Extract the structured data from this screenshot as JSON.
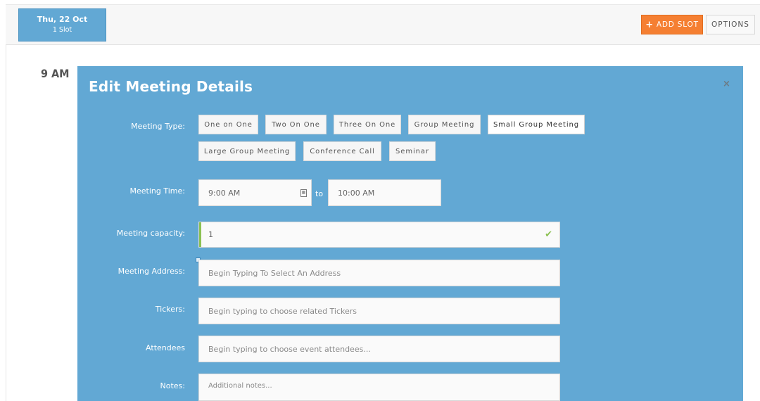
{
  "day_tab": {
    "date": "Thu, 22 Oct",
    "slots": "1 Slot"
  },
  "toolbar": {
    "add_slot_label": "ADD SLOT",
    "add_slot_icon": "+",
    "options_label": "OPTIONS"
  },
  "time_slot": {
    "label": "9 AM"
  },
  "panel": {
    "title": "Edit Meeting Details",
    "close_icon": "×"
  },
  "meeting_type": {
    "label": "Meeting Type:",
    "options": [
      "One on One",
      "Two On One",
      "Three On One",
      "Group Meeting",
      "Small Group Meeting",
      "Large Group Meeting",
      "Conference Call",
      "Seminar"
    ],
    "selected": "Small Group Meeting"
  },
  "meeting_time": {
    "label": "Meeting Time:",
    "start": "9:00 AM",
    "separator": "to",
    "end": "10:00 AM"
  },
  "capacity": {
    "label": "Meeting capacity:",
    "value": "1"
  },
  "address": {
    "label": "Meeting Address:",
    "placeholder": "Begin Typing To Select An Address"
  },
  "tickers": {
    "label": "Tickers:",
    "placeholder": "Begin typing to choose related Tickers"
  },
  "attendees": {
    "label": "Attendees",
    "placeholder": "Begin typing to choose event attendees..."
  },
  "notes": {
    "label": "Notes:",
    "placeholder": "Additional notes..."
  },
  "colors": {
    "panel": "#62a8d4",
    "accent_orange": "#f57f32",
    "valid_green": "#8cc152"
  }
}
